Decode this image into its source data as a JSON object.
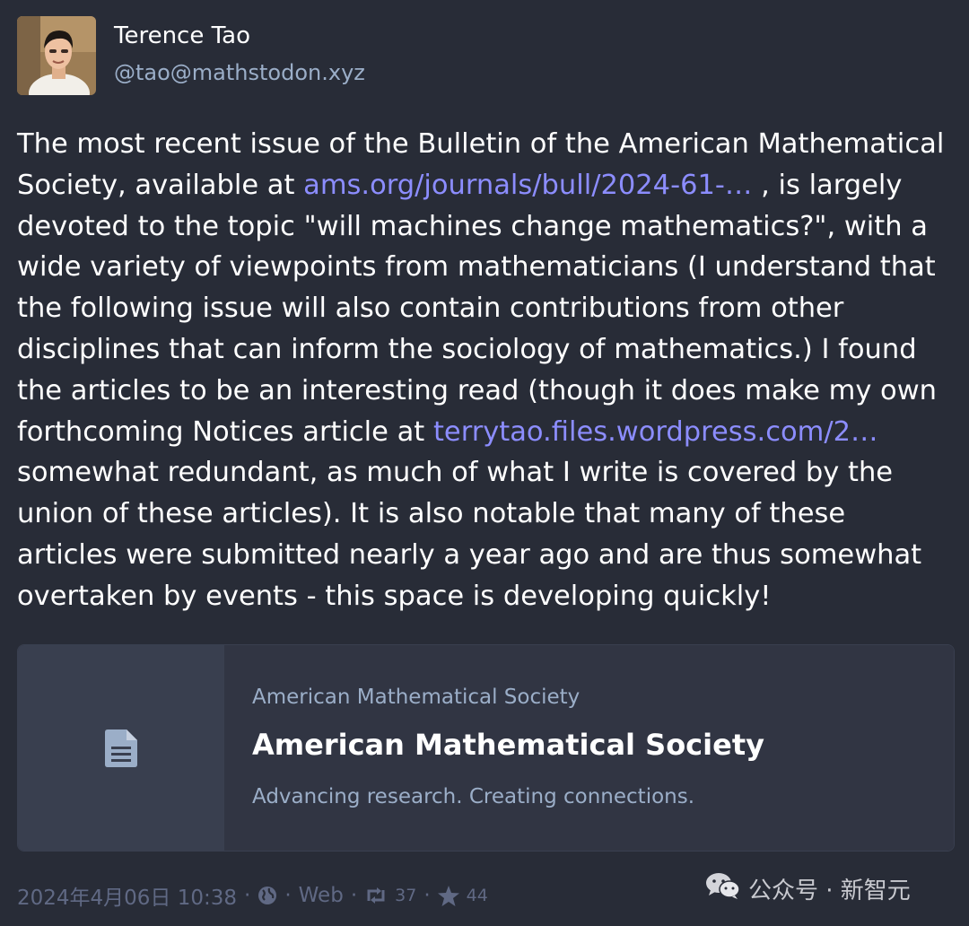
{
  "author": {
    "display_name": "Terence Tao",
    "handle": "@tao@mathstodon.xyz",
    "avatar_icon": "person-portrait"
  },
  "post": {
    "lines": [
      [
        {
          "text": "The most recent issue of the Bulletin of the American Mathematical"
        }
      ],
      [
        {
          "text": "Society, available at "
        },
        {
          "text": "ams.org/journals/bull/2024-61-…",
          "link": true
        },
        {
          "text": " , is largely"
        }
      ],
      [
        {
          "text": "devoted to the topic \"will machines change mathematics?\", with a"
        }
      ],
      [
        {
          "text": "wide variety of viewpoints from mathematicians (I understand that"
        }
      ],
      [
        {
          "text": "the following issue will also contain contributions from other"
        }
      ],
      [
        {
          "text": "disciplines that can inform the sociology of mathematics.)  I found"
        }
      ],
      [
        {
          "text": "the articles to be an interesting read (though it does make my own"
        }
      ],
      [
        {
          "text": "forthcoming Notices article at "
        },
        {
          "text": "terrytao.files.wordpress.com/2…",
          "link": true
        }
      ],
      [
        {
          "text": "somewhat redundant, as much of what I write is covered by the"
        }
      ],
      [
        {
          "text": "union of these articles).  It is also notable that many of these"
        }
      ],
      [
        {
          "text": "articles were submitted nearly a year ago and are thus somewhat"
        }
      ],
      [
        {
          "text": "overtaken by events - this space is developing quickly!"
        }
      ]
    ]
  },
  "card": {
    "provider": "American Mathematical Society",
    "title": "American Mathematical Society",
    "description": "Advancing research. Creating connections.",
    "thumb_icon": "file-text-icon"
  },
  "meta": {
    "timestamp": "2024年4月06日 10:38",
    "separator": "·",
    "visibility_icon": "globe-icon",
    "application": "Web",
    "reblog_count": "37",
    "favourite_count": "44"
  },
  "watermark": {
    "text": "公众号 · 新智元",
    "icon": "wechat-icon"
  },
  "colors": {
    "background": "#282c37",
    "link": "#8c8dff",
    "secondary_text": "#9baec8",
    "meta_text": "#606984",
    "card_thumb": "#393f4f"
  }
}
